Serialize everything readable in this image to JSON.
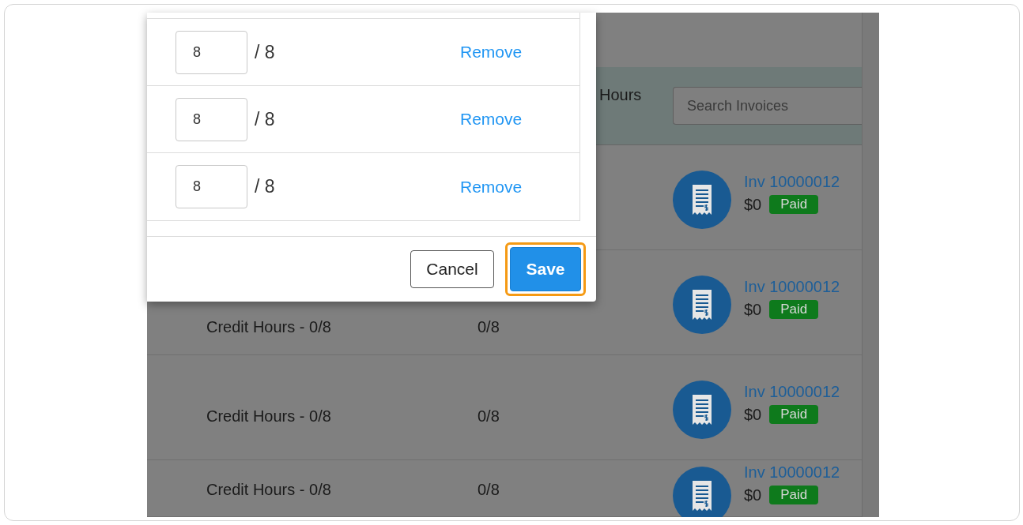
{
  "dialog": {
    "rows": [
      {
        "value": "8",
        "total": "/ 8",
        "action": "Remove"
      },
      {
        "value": "8",
        "total": "/ 8",
        "action": "Remove"
      },
      {
        "value": "8",
        "total": "/ 8",
        "action": "Remove"
      }
    ],
    "buttons": [
      {
        "label": "Cancel",
        "kind": "secondary",
        "focused": false
      },
      {
        "label": "Save",
        "kind": "primary",
        "focused": true
      }
    ]
  },
  "table": {
    "header": {
      "column_2": "Hours",
      "search": {
        "placeholder": "Search Invoices"
      }
    },
    "rows": [
      {
        "invoice": "Inv 10000012",
        "amount": "$0",
        "status": "Paid"
      },
      {
        "column_1": "Credit Hours - 0/8",
        "column_2": "0/8",
        "invoice": "Inv 10000012",
        "amount": "$0",
        "status": "Paid"
      },
      {
        "column_1": "Credit Hours - 0/8",
        "column_2": "0/8",
        "invoice": "Inv 10000012",
        "amount": "$0",
        "status": "Paid"
      },
      {
        "column_1": "Credit Hours - 0/8",
        "column_2": "0/8",
        "invoice": "Inv 10000012",
        "amount": "$0",
        "status": "Paid"
      }
    ]
  }
}
